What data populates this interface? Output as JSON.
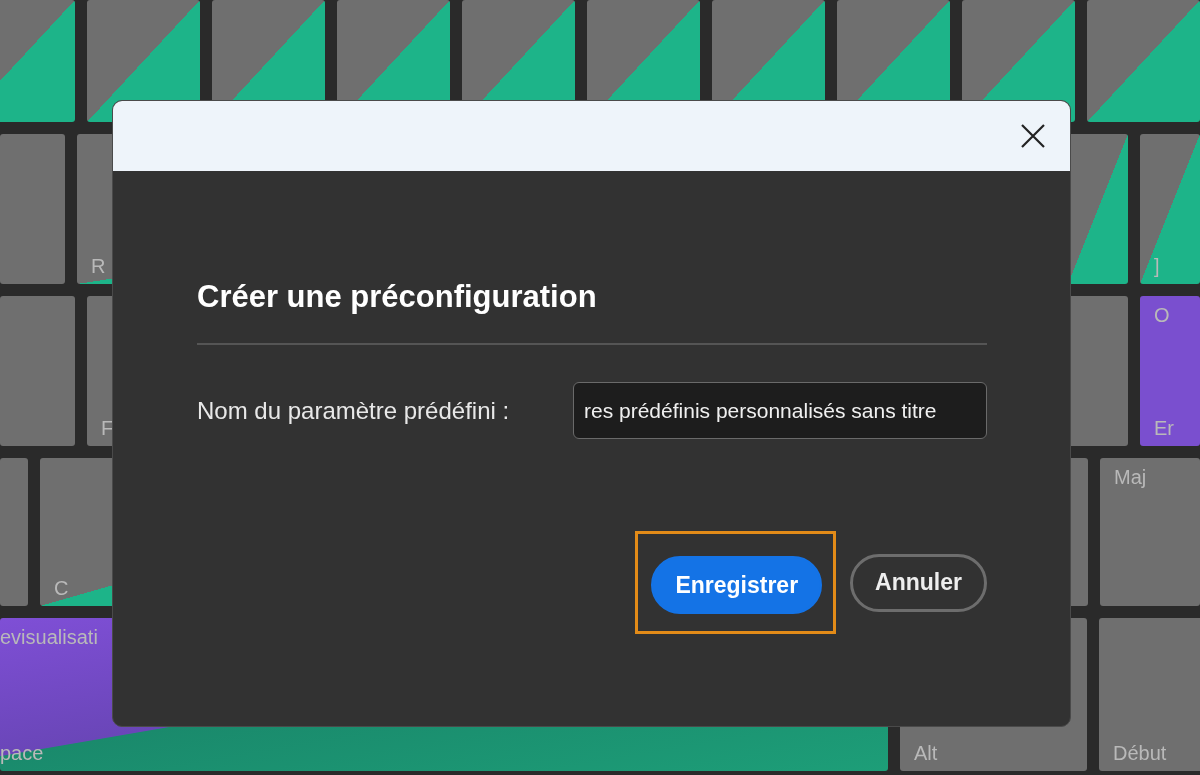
{
  "keyboard": {
    "rows": [
      {
        "keys": [
          {
            "kind": "accent"
          },
          {
            "kind": "accent"
          },
          {
            "kind": "accent"
          },
          {
            "kind": "accent"
          },
          {
            "kind": "accent"
          },
          {
            "kind": "accent"
          },
          {
            "kind": "accent"
          },
          {
            "kind": "accent"
          },
          {
            "kind": "accent"
          },
          {
            "kind": "accent"
          }
        ]
      },
      {
        "keys": [
          {
            "kind": "plain"
          },
          {
            "kind": "accent",
            "label": "R"
          },
          {
            "kind": "accent"
          },
          {
            "kind": "accent",
            "label": "]"
          }
        ]
      },
      {
        "keys": [
          {
            "kind": "plain"
          },
          {
            "kind": "plain",
            "label": "F"
          },
          {
            "kind": "plain"
          },
          {
            "kind": "purple",
            "top_label": "O",
            "label": "Er"
          }
        ]
      },
      {
        "keys": [
          {
            "kind": "plain"
          },
          {
            "kind": "accent",
            "label": "C"
          },
          {
            "kind": "plain"
          },
          {
            "kind": "plain",
            "top_label": "Maj"
          }
        ]
      },
      {
        "keys": [
          {
            "kind": "space",
            "top_label": "evisualisati",
            "label": "pace"
          },
          {
            "kind": "plain",
            "label": "Alt"
          },
          {
            "kind": "plain",
            "label": "Début"
          }
        ]
      }
    ]
  },
  "dialog": {
    "title": "Créer une préconfiguration",
    "field": {
      "label": "Nom du paramètre prédéfini :",
      "value": "res prédéfinis personnalisés sans titre"
    },
    "buttons": [
      {
        "label": "Enregistrer",
        "kind": "primary",
        "focused": true
      },
      {
        "label": "Annuler",
        "kind": "secondary",
        "focused": false
      }
    ]
  }
}
